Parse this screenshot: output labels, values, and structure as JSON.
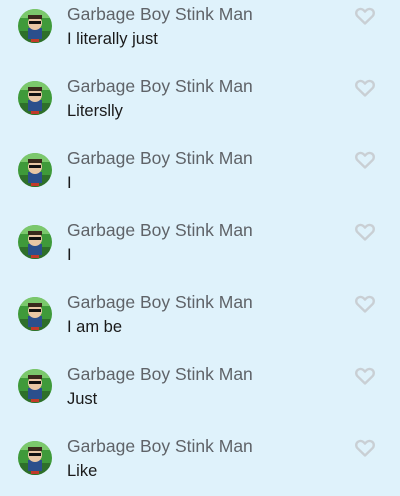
{
  "messages": [
    {
      "author": "Garbage Boy Stink Man",
      "text": "I literally just"
    },
    {
      "author": "Garbage Boy Stink Man",
      "text": "Literslly"
    },
    {
      "author": "Garbage Boy Stink Man",
      "text": "I"
    },
    {
      "author": "Garbage Boy Stink Man",
      "text": "I"
    },
    {
      "author": "Garbage Boy Stink Man",
      "text": "I am be"
    },
    {
      "author": "Garbage Boy Stink Man",
      "text": "Just"
    },
    {
      "author": "Garbage Boy Stink Man",
      "text": "Like"
    }
  ],
  "icons": {
    "avatar": "avatar-icon",
    "like": "heart-icon"
  },
  "colors": {
    "background": "#dff2fb",
    "author": "#5f6368",
    "text": "#1a1a1a",
    "heart": "#c9cfd4"
  }
}
